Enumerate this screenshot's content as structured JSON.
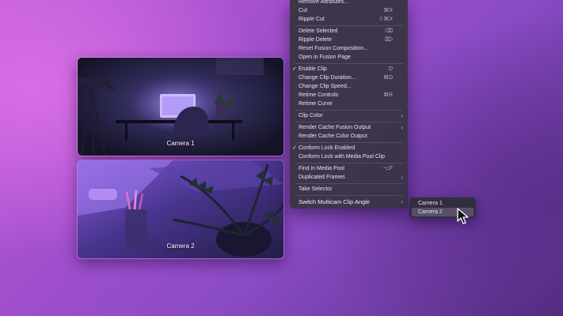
{
  "clips": [
    {
      "label": "Camera 1"
    },
    {
      "label": "Camera 2"
    }
  ],
  "menu": {
    "items": [
      {
        "label": "Remove Attributes...",
        "shortcut": ""
      },
      {
        "label": "Cut",
        "shortcut": "⌘X"
      },
      {
        "label": "Ripple Cut",
        "shortcut": "⇧⌘X"
      },
      {
        "label": "Delete Selected",
        "shortcut": "⌫"
      },
      {
        "label": "Ripple Delete",
        "shortcut": "⌦"
      },
      {
        "label": "Reset Fusion Composition...",
        "shortcut": ""
      },
      {
        "label": "Open in Fusion Page",
        "shortcut": ""
      },
      {
        "label": "Enable Clip",
        "shortcut": "D",
        "checked": true
      },
      {
        "label": "Change Clip Duration...",
        "shortcut": "⌘D"
      },
      {
        "label": "Change Clip Speed...",
        "shortcut": ""
      },
      {
        "label": "Retime Controls",
        "shortcut": "⌘R"
      },
      {
        "label": "Retime Curve",
        "shortcut": ""
      },
      {
        "label": "Clip Color",
        "submenu": true
      },
      {
        "label": "Render Cache Fusion Output",
        "submenu": true
      },
      {
        "label": "Render Cache Color Output",
        "shortcut": ""
      },
      {
        "label": "Conform Lock Enabled",
        "shortcut": "",
        "checked": true
      },
      {
        "label": "Conform Lock with Media Pool Clip",
        "shortcut": ""
      },
      {
        "label": "Find in Media Pool",
        "shortcut": "⌥F"
      },
      {
        "label": "Duplicated Frames",
        "submenu": true
      },
      {
        "label": "Take Selector",
        "shortcut": ""
      },
      {
        "label": "Switch Multicam Clip Angle",
        "submenu": true
      }
    ]
  },
  "submenu": {
    "items": [
      {
        "label": "Camera 1"
      },
      {
        "label": "Camera 2"
      }
    ],
    "highlighted": "Camera 2"
  },
  "colors": {
    "menu_bg": "#3a3446",
    "highlight": "#575068"
  }
}
